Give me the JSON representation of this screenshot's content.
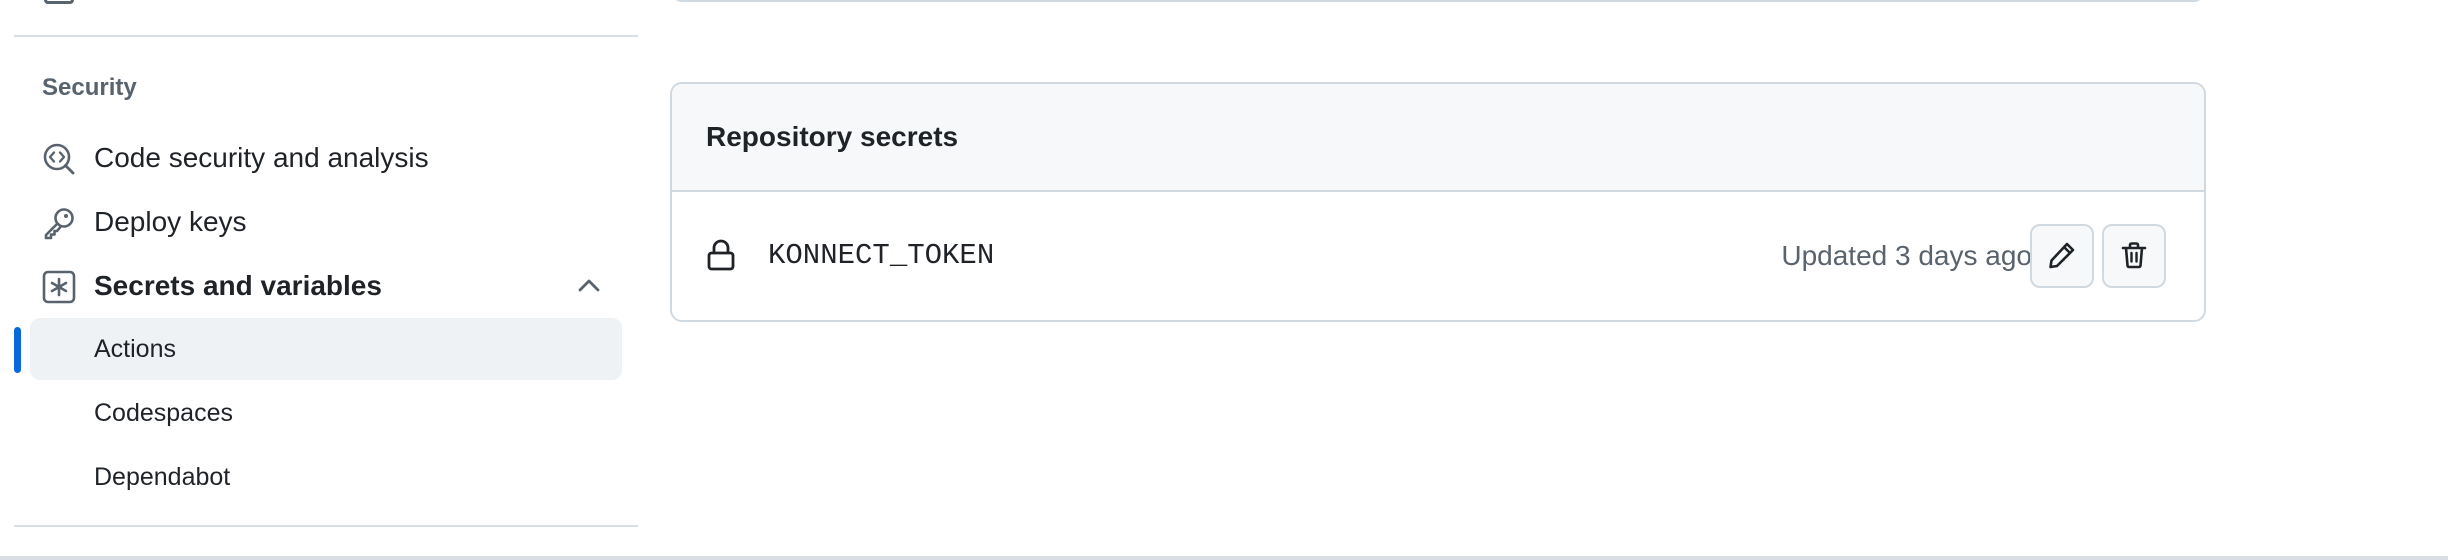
{
  "sidebar": {
    "section_heading": "Security",
    "items": [
      {
        "label": "Code security and analysis",
        "icon": "codescan-icon"
      },
      {
        "label": "Deploy keys",
        "icon": "key-icon"
      },
      {
        "label": "Secrets and variables",
        "icon": "asterisk-icon",
        "expanded": true
      }
    ],
    "subitems": [
      {
        "label": "Actions",
        "active": true
      },
      {
        "label": "Codespaces",
        "active": false
      },
      {
        "label": "Dependabot",
        "active": false
      }
    ]
  },
  "secrets": {
    "title": "Repository secrets",
    "rows": [
      {
        "name": "KONNECT_TOKEN",
        "updated": "Updated 3 days ago"
      }
    ]
  },
  "colors": {
    "accent": "#0969da",
    "active_bg": "#eff2f5",
    "header_bg": "#f6f8fa",
    "border": "#d1d9e0",
    "muted_text": "#59636e"
  }
}
